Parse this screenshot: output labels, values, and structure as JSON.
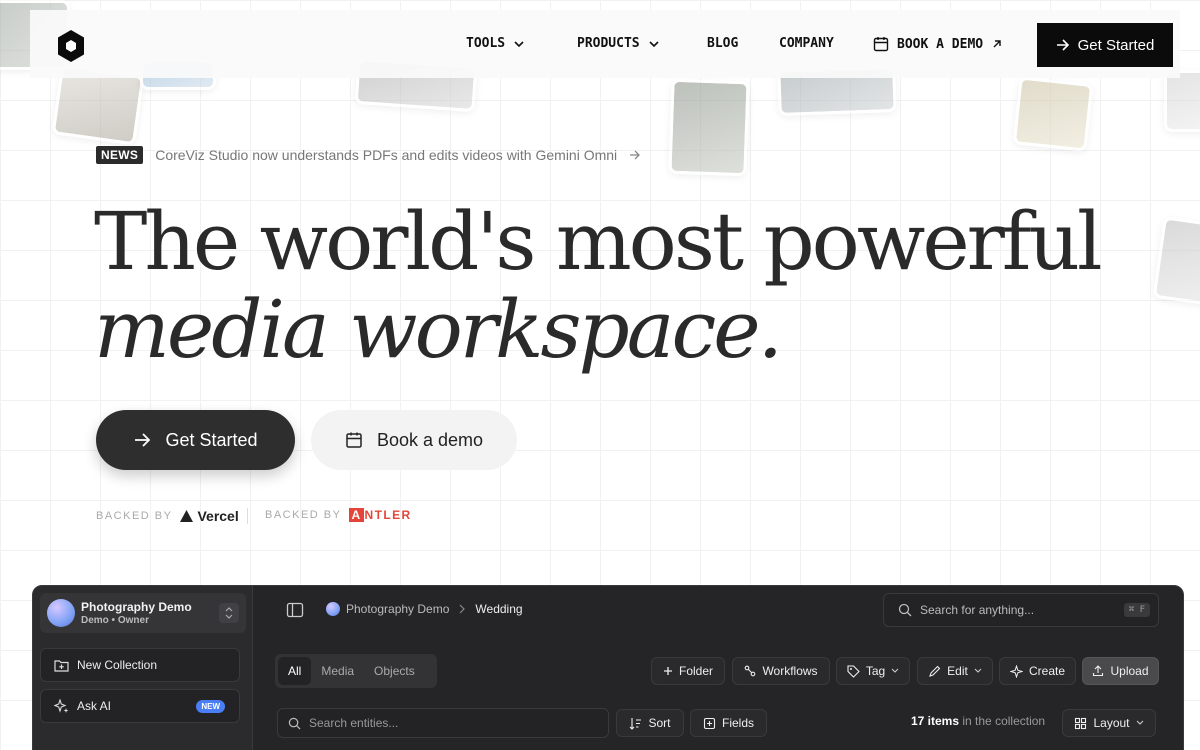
{
  "nav": {
    "items": [
      {
        "label": "TOOLS",
        "has_dropdown": true
      },
      {
        "label": "PRODUCTS",
        "has_dropdown": true
      },
      {
        "label": "BLOG",
        "has_dropdown": false
      },
      {
        "label": "COMPANY",
        "has_dropdown": false
      }
    ],
    "book_demo": "BOOK A DEMO",
    "cta": "Get Started"
  },
  "news": {
    "badge": "NEWS",
    "text": "CoreViz Studio now understands PDFs and edits videos with Gemini Omni"
  },
  "hero": {
    "line1": "The world's most powerful",
    "line2": "media workspace.",
    "primary_cta": "Get Started",
    "secondary_cta": "Book a demo"
  },
  "backers": [
    {
      "prefix": "BACKED BY",
      "name": "Vercel"
    },
    {
      "prefix": "BACKED BY",
      "name": "ANTLER"
    }
  ],
  "app": {
    "workspace": {
      "name": "Photography Demo",
      "subtitle": "Demo • Owner"
    },
    "sidebar": [
      {
        "label": "New Collection",
        "icon": "folder-plus-icon"
      },
      {
        "label": "Ask AI",
        "icon": "sparkle-icon",
        "badge": "NEW"
      }
    ],
    "breadcrumb": [
      "Photography Demo",
      "Wedding"
    ],
    "search": {
      "placeholder": "Search for anything...",
      "shortcut": "⌘ F"
    },
    "tabs": [
      "All",
      "Media",
      "Objects"
    ],
    "active_tab": "All",
    "actions": [
      "Folder",
      "Workflows",
      "Tag",
      "Edit",
      "Create",
      "Upload"
    ],
    "entity_search_placeholder": "Search entities...",
    "sort_label": "Sort",
    "fields_label": "Fields",
    "count": "17 items",
    "count_suffix": "in the collection",
    "layout_label": "Layout"
  },
  "colors": {
    "accent_dark": "#0b0b0b",
    "antler_red": "#e4453a",
    "app_bg": "#252527",
    "new_badge": "#4a7ef7"
  }
}
